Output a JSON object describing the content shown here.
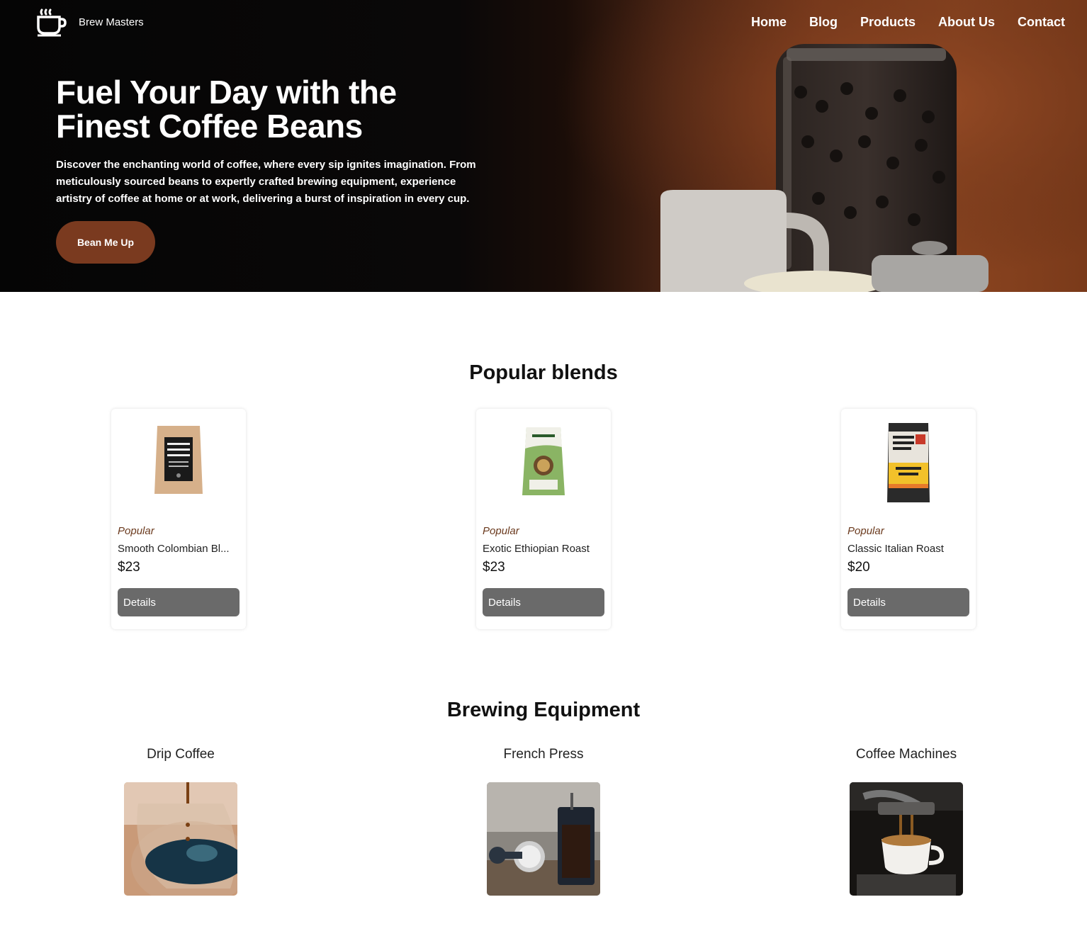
{
  "header": {
    "brand": "Brew Masters",
    "nav": [
      "Home",
      "Blog",
      "Products",
      "About Us",
      "Contact"
    ]
  },
  "hero": {
    "title_line1": "Fuel Your Day with the",
    "title_line2": "Finest Coffee Beans",
    "text": "Discover the enchanting world of coffee, where every sip ignites imagination. From meticulously sourced beans to expertly crafted brewing equipment, experience artistry of coffee at home or at work, delivering a burst of inspiration in every cup.",
    "cta": "Bean Me Up"
  },
  "blends": {
    "title": "Popular blends",
    "items": [
      {
        "tag": "Popular",
        "name": "Smooth Colombian Bl...",
        "price": "$23",
        "button": "Details",
        "image": "brooklyn-coffee-bag"
      },
      {
        "tag": "Popular",
        "name": "Exotic Ethiopian Roast",
        "price": "$23",
        "button": "Details",
        "image": "lavazza-organic-bag"
      },
      {
        "tag": "Popular",
        "name": "Classic Italian Roast",
        "price": "$20",
        "button": "Details",
        "image": "san-francisco-bay-breakfast-blend-bag"
      }
    ]
  },
  "equipment": {
    "title": "Brewing Equipment",
    "items": [
      {
        "label": "Drip Coffee",
        "image": "drip-coffee-photo"
      },
      {
        "label": "French Press",
        "image": "french-press-photo"
      },
      {
        "label": "Coffee Machines",
        "image": "espresso-machine-photo"
      }
    ]
  },
  "colors": {
    "accent": "#7a3a1f",
    "tag": "#6b3a1e",
    "button_grey": "#6a6a6a"
  }
}
